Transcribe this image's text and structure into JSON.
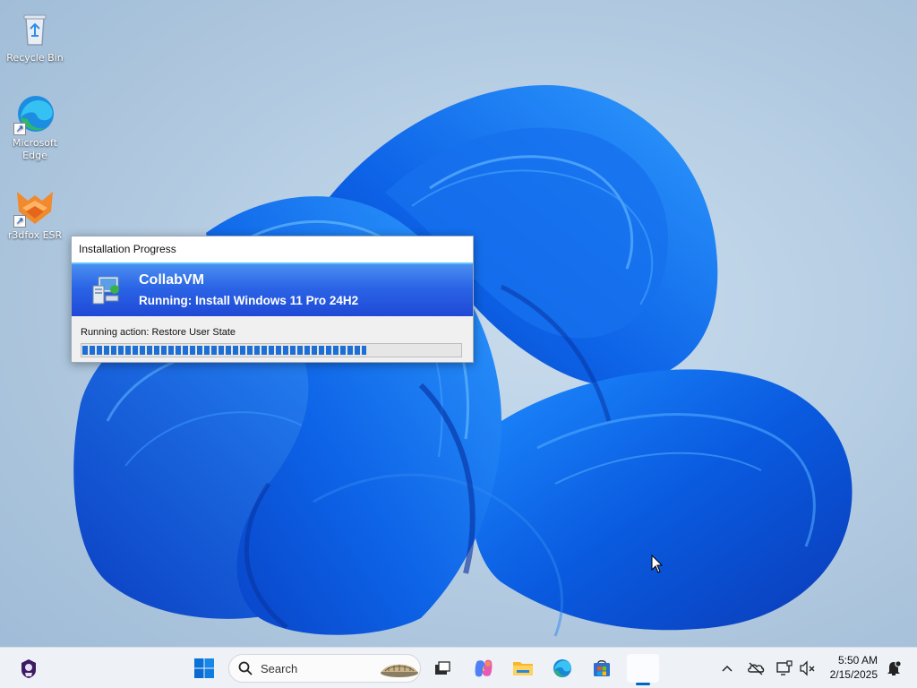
{
  "desktop": {
    "icons": [
      {
        "label": "Recycle Bin"
      },
      {
        "label": "Microsoft Edge"
      },
      {
        "label": "r3dfox ESR"
      }
    ]
  },
  "dialog": {
    "title": "Installation Progress",
    "product_name": "CollabVM",
    "status": "Running: Install Windows 11 Pro 24H2",
    "action_text": "Running action: Restore User State",
    "progress": 0.75
  },
  "taskbar": {
    "search_placeholder": "Search",
    "time": "5:50 AM",
    "date": "2/15/2025",
    "pinned": [
      "start-icon",
      "search-icon",
      "task-view-icon",
      "copilot-icon",
      "file-explorer-icon",
      "edge-icon",
      "store-icon",
      "open-app-icon"
    ],
    "tray": [
      "chevron-up-icon",
      "onedrive-icon",
      "network-icon",
      "volume-muted-icon",
      "notifications-icon"
    ]
  },
  "colors": {
    "banner_top": "#4a8ff0",
    "banner_bottom": "#1f49d6",
    "progress": "#1d6fd6",
    "accent": "#0067c0"
  }
}
